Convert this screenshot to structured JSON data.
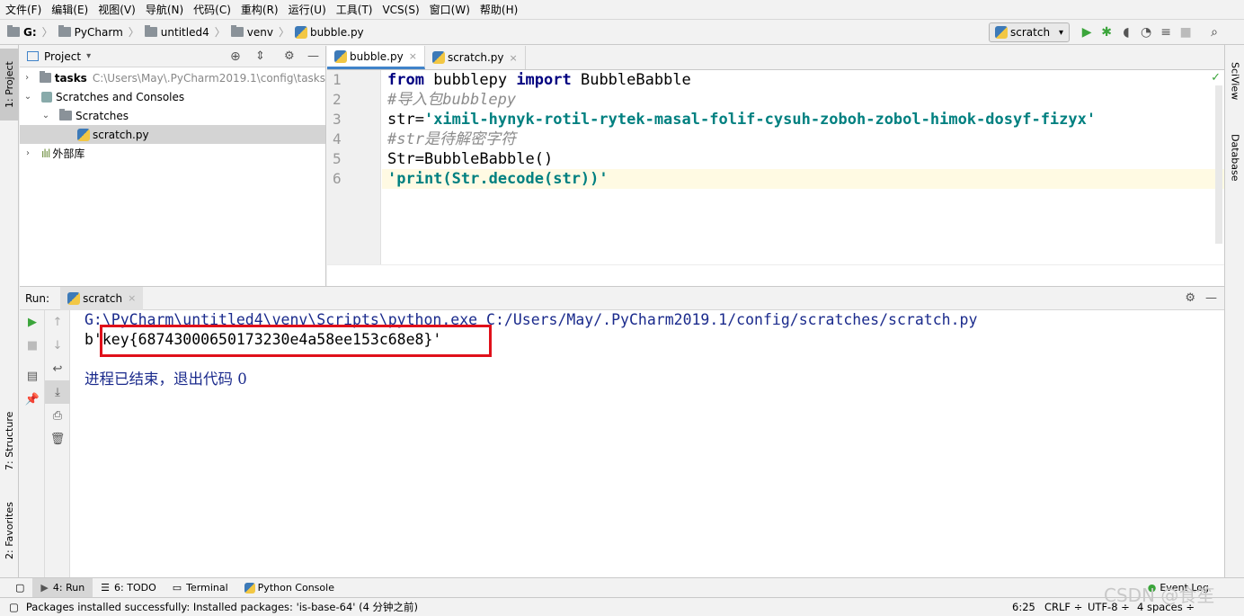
{
  "menu": [
    "文件(F)",
    "编辑(E)",
    "视图(V)",
    "导航(N)",
    "代码(C)",
    "重构(R)",
    "运行(U)",
    "工具(T)",
    "VCS(S)",
    "窗口(W)",
    "帮助(H)"
  ],
  "breadcrumb": {
    "drive": "G:",
    "items": [
      "PyCharm",
      "untitled4",
      "venv"
    ],
    "file": "bubble.py"
  },
  "run_config": {
    "selected": "scratch"
  },
  "left_stripe": {
    "project": "1: Project",
    "structure": "7: Structure",
    "favorites": "2: Favorites"
  },
  "right_stripe": {
    "sciview": "SciView",
    "database": "Database"
  },
  "project_panel": {
    "title": "Project",
    "tree": [
      {
        "label": "tasks",
        "path": "C:\\Users\\May\\.PyCharm2019.1\\config\\tasks"
      },
      {
        "label": "Scratches and Consoles"
      },
      {
        "label": "Scratches"
      },
      {
        "label": "scratch.py"
      },
      {
        "label": "外部库"
      }
    ]
  },
  "editor": {
    "tabs": [
      {
        "label": "bubble.py"
      },
      {
        "label": "scratch.py"
      }
    ],
    "line_numbers": [
      "1",
      "2",
      "3",
      "4",
      "5",
      "6"
    ],
    "lines": {
      "l1_kw1": "from",
      "l1_mod": " bubblepy ",
      "l1_kw2": "import",
      "l1_name": " BubbleBabble",
      "l2_comment": "#导入包bubblepy",
      "l3_var": "str=",
      "l3_str": "'ximil-hynyk-rotil-rytek-masal-folif-cysuh-zoboh-zobol-himok-dosyf-fizyx'",
      "l4_comment": "#str是待解密字符",
      "l5_code": "Str=BubbleBabble()",
      "l6_str": "'print(Str.decode(str))'"
    }
  },
  "run_panel": {
    "label": "Run:",
    "tab": "scratch",
    "output": {
      "cmd": "G:\\PyCharm\\untitled4\\venv\\Scripts\\python.exe C:/Users/May/.PyCharm2019.1/config/scratches/scratch.py",
      "result": "b'key{68743000650173230e4a58ee153c68e8}'",
      "exit": "进程已结束，退出代码 0"
    }
  },
  "tool_windows": {
    "run": "4: Run",
    "todo": "6: TODO",
    "terminal": "Terminal",
    "python_console": "Python Console",
    "event_log": "Event Log"
  },
  "status": {
    "message": "Packages installed successfully: Installed packages: 'is-base-64' (4 分钟之前)",
    "position": "6:25",
    "line_sep": "CRLF ÷",
    "encoding": "UTF-8 ÷",
    "indent": "4 spaces ÷"
  },
  "watermark": "CSDN @食笙",
  "colors": {
    "keyword": "#000080",
    "string": "#008080",
    "comment": "#8c8c8c",
    "highlight_box": "#e0101a",
    "run_green": "#3ba53b"
  }
}
